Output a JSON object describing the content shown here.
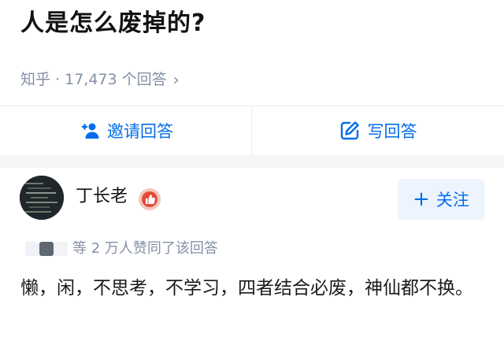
{
  "question": {
    "title": "人是怎么废掉的?",
    "meta": "知乎 · 17,473 个回答",
    "chevron": "›"
  },
  "actions": {
    "invite_label": "邀请回答",
    "write_label": "写回答",
    "icon_color": "#056de8"
  },
  "answer": {
    "author_name": "丁长老",
    "follow_label": "关注",
    "follow_icon": "+",
    "upvote_text": "等 2 万人赞同了该回答",
    "content": "懒，闲，不思考，不学习，四者结合必废，神仙都不换。",
    "badge_icon": "thumbs-up-icon"
  },
  "colors": {
    "brand_blue": "#056de8",
    "meta_gray": "#8590a6",
    "band_gray": "#f6f6f6"
  }
}
